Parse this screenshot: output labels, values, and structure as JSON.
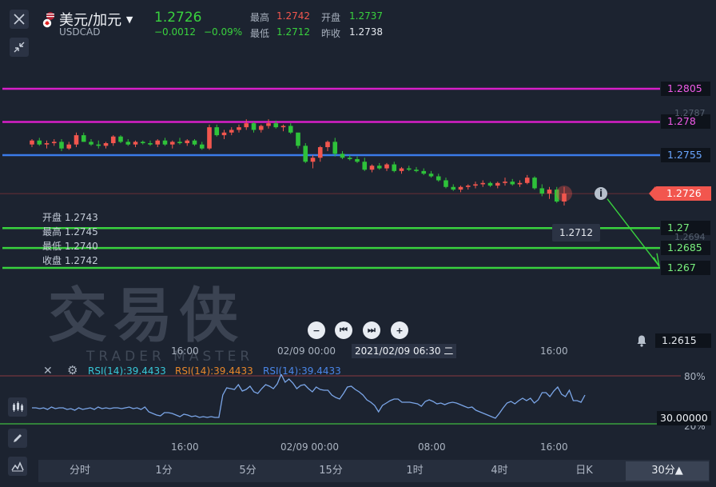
{
  "header": {
    "pair": "美元/加元",
    "symbol": "USDCAD",
    "price": "1.2726",
    "change": "−0.0012",
    "change_pct": "−0.09%",
    "high_label": "最高",
    "high": "1.2742",
    "open_label": "开盘",
    "open": "1.2737",
    "low_label": "最低",
    "low": "1.2712",
    "prev_label": "昨收",
    "prev": "1.2738"
  },
  "levels": [
    {
      "label": "1.2805",
      "price": 1.2805,
      "color": "#d81ec8"
    },
    {
      "label": "1.278",
      "price": 1.278,
      "color": "#d81ec8"
    },
    {
      "label": "1.2755",
      "price": 1.2755,
      "color": "#3a7be8"
    },
    {
      "label": "1.27",
      "price": 1.27,
      "color": "#39d23e"
    },
    {
      "label": "1.2685",
      "price": 1.2685,
      "color": "#39d23e"
    },
    {
      "label": "1.267",
      "price": 1.267,
      "color": "#39d23e"
    }
  ],
  "current_price_tag": "1.2726",
  "faint_labels": {
    "top": "1.2787",
    "bottom": "1.2694"
  },
  "low_marker": "1.2712",
  "alert_price": "1.2615",
  "ohlc_tooltip": {
    "open": "开盘 1.2743",
    "high": "最高 1.2745",
    "low": "最低 1.2740",
    "close": "收盘 1.2742"
  },
  "watermark": {
    "cn": "交易侠",
    "en": "TRADER MASTER"
  },
  "crosshair_time": "2021/02/09 06:30 二",
  "main_axis": {
    "t1": "16:00",
    "t2": "02/09 00:00",
    "t3": "16:00"
  },
  "rsi": {
    "labels": [
      "RSI(14):39.4433",
      "RSI(14):39.4433",
      "RSI(14):39.4433"
    ],
    "label_colors": [
      "#38c8d8",
      "#e8872a",
      "#4a86e8"
    ],
    "overbought": "80%",
    "oversold": "20%",
    "current_tag": "30.00000",
    "values": [
      40,
      40,
      39,
      40,
      38,
      41,
      39,
      40,
      40,
      38,
      39,
      37,
      40,
      38,
      39,
      40,
      38,
      41,
      39,
      40,
      39,
      40,
      40,
      39,
      40,
      41,
      39,
      40,
      38,
      41,
      35,
      33,
      31,
      30,
      34,
      34,
      33,
      31,
      29,
      32,
      31,
      29,
      30,
      28,
      29,
      28,
      29,
      28,
      28,
      56,
      65,
      64,
      63,
      69,
      61,
      63,
      67,
      60,
      58,
      64,
      69,
      67,
      64,
      70,
      82,
      72,
      76,
      71,
      64,
      68,
      69,
      64,
      60,
      66,
      63,
      62,
      62,
      56,
      53,
      51,
      58,
      66,
      67,
      63,
      60,
      56,
      50,
      47,
      43,
      35,
      43,
      46,
      49,
      51,
      51,
      47,
      47,
      47,
      46,
      45,
      42,
      48,
      50,
      48,
      45,
      46,
      44,
      46,
      47,
      46,
      44,
      42,
      40,
      41,
      37,
      35,
      33,
      31,
      29,
      27,
      33,
      40,
      46,
      48,
      45,
      49,
      52,
      49,
      52,
      46,
      50,
      59,
      59,
      54,
      61,
      66,
      57,
      54,
      62,
      49,
      49,
      47,
      56
    ]
  },
  "rsi_axis": {
    "t1": "16:00",
    "t2": "02/09 00:00",
    "t3": "08:00",
    "t4": "16:00"
  },
  "timeframes": [
    "分时",
    "1分",
    "5分",
    "15分",
    "1时",
    "4时",
    "日K",
    "30分▲"
  ],
  "colors": {
    "up": "#f2564e",
    "down": "#2ec23a",
    "bg": "#1c2330"
  },
  "candles": [
    [
      1.2763,
      1.2767,
      1.2761,
      1.2766
    ],
    [
      1.2766,
      1.2768,
      1.2762,
      1.2763
    ],
    [
      1.2763,
      1.2766,
      1.276,
      1.2764
    ],
    [
      1.2764,
      1.2767,
      1.2762,
      1.2765
    ],
    [
      1.2765,
      1.2767,
      1.2758,
      1.276
    ],
    [
      1.276,
      1.2765,
      1.2759,
      1.2763
    ],
    [
      1.2763,
      1.2772,
      1.2761,
      1.277
    ],
    [
      1.277,
      1.2772,
      1.2765,
      1.2765
    ],
    [
      1.2765,
      1.2767,
      1.2762,
      1.2763
    ],
    [
      1.2763,
      1.2766,
      1.276,
      1.2762
    ],
    [
      1.2762,
      1.2765,
      1.276,
      1.2764
    ],
    [
      1.2764,
      1.277,
      1.2762,
      1.2769
    ],
    [
      1.2769,
      1.277,
      1.2764,
      1.2765
    ],
    [
      1.2765,
      1.2767,
      1.2762,
      1.2763
    ],
    [
      1.2763,
      1.2766,
      1.2761,
      1.2765
    ],
    [
      1.2765,
      1.2766,
      1.2763,
      1.2764
    ],
    [
      1.2764,
      1.2766,
      1.2762,
      1.2763
    ],
    [
      1.2763,
      1.2767,
      1.2761,
      1.2766
    ],
    [
      1.2766,
      1.2768,
      1.2762,
      1.2763
    ],
    [
      1.2763,
      1.2766,
      1.276,
      1.2765
    ],
    [
      1.2765,
      1.2768,
      1.2763,
      1.2764
    ],
    [
      1.2764,
      1.2767,
      1.2762,
      1.2766
    ],
    [
      1.2766,
      1.2767,
      1.2762,
      1.2763
    ],
    [
      1.2763,
      1.2765,
      1.2759,
      1.276
    ],
    [
      1.276,
      1.2778,
      1.2759,
      1.2776
    ],
    [
      1.2776,
      1.2778,
      1.2769,
      1.277
    ],
    [
      1.277,
      1.2774,
      1.2767,
      1.2772
    ],
    [
      1.2772,
      1.2776,
      1.277,
      1.2774
    ],
    [
      1.2774,
      1.2778,
      1.2772,
      1.2776
    ],
    [
      1.2776,
      1.2782,
      1.2774,
      1.2779
    ],
    [
      1.2779,
      1.278,
      1.2772,
      1.2774
    ],
    [
      1.2774,
      1.2778,
      1.2772,
      1.2777
    ],
    [
      1.2777,
      1.2782,
      1.2775,
      1.2779
    ],
    [
      1.2779,
      1.2781,
      1.2775,
      1.2776
    ],
    [
      1.2776,
      1.2778,
      1.2773,
      1.2777
    ],
    [
      1.2777,
      1.2779,
      1.2771,
      1.2772
    ],
    [
      1.2772,
      1.2764,
      1.276,
      1.2762
    ],
    [
      1.2762,
      1.2764,
      1.2749,
      1.275
    ],
    [
      1.275,
      1.2755,
      1.2745,
      1.2753
    ],
    [
      1.2753,
      1.2762,
      1.275,
      1.2761
    ],
    [
      1.2761,
      1.2766,
      1.2758,
      1.2765
    ],
    [
      1.2765,
      1.2768,
      1.2754,
      1.2756
    ],
    [
      1.2756,
      1.2758,
      1.2752,
      1.2753
    ],
    [
      1.2753,
      1.2755,
      1.2751,
      1.2752
    ],
    [
      1.2752,
      1.2754,
      1.2749,
      1.275
    ],
    [
      1.275,
      1.2753,
      1.2743,
      1.2744
    ],
    [
      1.2744,
      1.2748,
      1.2742,
      1.2747
    ],
    [
      1.2747,
      1.2749,
      1.2744,
      1.2745
    ],
    [
      1.2745,
      1.2749,
      1.2743,
      1.2748
    ],
    [
      1.2748,
      1.275,
      1.2742,
      1.2743
    ],
    [
      1.2743,
      1.2746,
      1.2741,
      1.2745
    ],
    [
      1.2745,
      1.2747,
      1.2743,
      1.2744
    ],
    [
      1.2744,
      1.2746,
      1.2742,
      1.2743
    ],
    [
      1.2743,
      1.2745,
      1.274,
      1.2741
    ],
    [
      1.2741,
      1.2743,
      1.2738,
      1.2739
    ],
    [
      1.2739,
      1.2741,
      1.2735,
      1.2736
    ],
    [
      1.2736,
      1.2738,
      1.273,
      1.2731
    ],
    [
      1.2731,
      1.2733,
      1.2728,
      1.2729
    ],
    [
      1.2729,
      1.2732,
      1.2727,
      1.2731
    ],
    [
      1.2731,
      1.2733,
      1.2729,
      1.2732
    ],
    [
      1.2732,
      1.2735,
      1.273,
      1.2733
    ],
    [
      1.2733,
      1.2736,
      1.2731,
      1.2734
    ],
    [
      1.2734,
      1.2735,
      1.2731,
      1.2732
    ],
    [
      1.2732,
      1.2735,
      1.273,
      1.2734
    ],
    [
      1.2734,
      1.2738,
      1.2732,
      1.2735
    ],
    [
      1.2735,
      1.2737,
      1.2732,
      1.2733
    ],
    [
      1.2733,
      1.2736,
      1.2731,
      1.2734
    ],
    [
      1.2734,
      1.274,
      1.2733,
      1.2738
    ],
    [
      1.2738,
      1.2739,
      1.2729,
      1.273
    ],
    [
      1.273,
      1.2733,
      1.2724,
      1.2726
    ],
    [
      1.2726,
      1.2731,
      1.2722,
      1.2729
    ],
    [
      1.2729,
      1.2731,
      1.2719,
      1.272
    ],
    [
      1.272,
      1.2731,
      1.2717,
      1.2726
    ]
  ]
}
